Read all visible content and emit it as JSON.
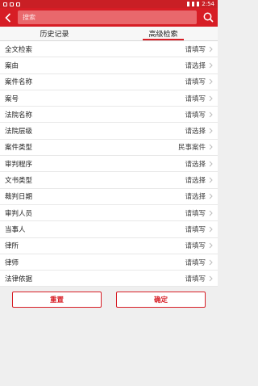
{
  "statusbar": {
    "time": "2:54"
  },
  "header": {
    "search_placeholder": "搜索"
  },
  "tabs": [
    {
      "label": "历史记录",
      "active": false
    },
    {
      "label": "高级检索",
      "active": true
    }
  ],
  "form": {
    "rows": [
      {
        "label": "全文检索",
        "value": "请填写"
      },
      {
        "label": "案由",
        "value": "请选择"
      },
      {
        "label": "案件名称",
        "value": "请填写"
      },
      {
        "label": "案号",
        "value": "请填写"
      },
      {
        "label": "法院名称",
        "value": "请填写"
      },
      {
        "label": "法院层级",
        "value": "请选择"
      },
      {
        "label": "案件类型",
        "value": "民事案件"
      },
      {
        "label": "审判程序",
        "value": "请选择"
      },
      {
        "label": "文书类型",
        "value": "请选择"
      },
      {
        "label": "裁判日期",
        "value": "请选择"
      },
      {
        "label": "审判人员",
        "value": "请填写"
      },
      {
        "label": "当事人",
        "value": "请填写"
      },
      {
        "label": "律所",
        "value": "请填写"
      },
      {
        "label": "律师",
        "value": "请填写"
      },
      {
        "label": "法律依据",
        "value": "请填写"
      }
    ]
  },
  "actions": {
    "reset_label": "重置",
    "confirm_label": "确定"
  },
  "colors": {
    "accent": "#d71d25",
    "background": "#efefef"
  }
}
